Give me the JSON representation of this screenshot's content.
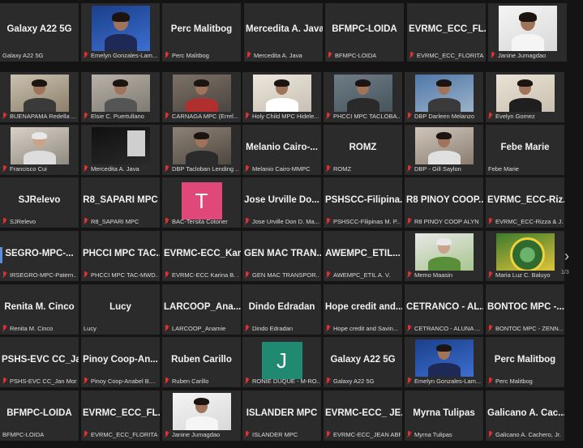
{
  "top_strip": [
    {
      "name": "Galaxy A22 5G",
      "caption": "Galaxy A22 5G",
      "muted": false,
      "kind": "name"
    },
    {
      "name": "",
      "caption": "Emelyn Gonzales-Lam...",
      "muted": true,
      "kind": "video",
      "video": "stage"
    },
    {
      "name": "Perc Malitbog",
      "caption": "Perc Malitbog",
      "muted": true,
      "kind": "name"
    },
    {
      "name": "Mercedita A. Java",
      "caption": "Mercedita A. Java",
      "muted": true,
      "kind": "name"
    },
    {
      "name": "BFMPC-LOIDA",
      "caption": "BFMPC-LOIDA",
      "muted": true,
      "kind": "name"
    },
    {
      "name": "EVRMC_ECC_FL...",
      "caption": "EVRMC_ECC_FLORITA ...",
      "muted": true,
      "kind": "name"
    },
    {
      "name": "",
      "caption": "Janine Jumagdao",
      "muted": true,
      "kind": "video",
      "video": "portrait"
    }
  ],
  "grid": [
    [
      {
        "name": "",
        "caption": "BUENAPAMA Redella ...",
        "muted": true,
        "kind": "video",
        "video": "office"
      },
      {
        "name": "",
        "caption": "Elsie C. Puertullano",
        "muted": true,
        "kind": "video",
        "video": "room"
      },
      {
        "name": "",
        "caption": "CARNAGA MPC (Errel...",
        "muted": true,
        "kind": "video",
        "video": "office2"
      },
      {
        "name": "",
        "caption": "Holy Child MPC Hidele...",
        "muted": true,
        "kind": "video",
        "video": "light"
      },
      {
        "name": "",
        "caption": "PHCCI MPC TACLOBA...",
        "muted": true,
        "kind": "video",
        "video": "office3"
      },
      {
        "name": "",
        "caption": "DBP Darleen Melanzo",
        "muted": true,
        "kind": "video",
        "video": "city"
      },
      {
        "name": "",
        "caption": "Evelyn Gomez",
        "muted": true,
        "kind": "video",
        "video": "wall"
      }
    ],
    [
      {
        "name": "",
        "caption": "Francisco Cui",
        "muted": true,
        "kind": "video",
        "video": "elder"
      },
      {
        "name": "",
        "caption": "Mercedita A. Java",
        "muted": true,
        "kind": "video",
        "video": "dark"
      },
      {
        "name": "",
        "caption": "DBP Tacloban Lending ...",
        "muted": true,
        "kind": "video",
        "video": "mask"
      },
      {
        "name": "Melanio Cairo-...",
        "caption": "Melanio Cairo-MMPC",
        "muted": true,
        "kind": "name"
      },
      {
        "name": "ROMZ",
        "caption": "ROMZ",
        "muted": true,
        "kind": "name"
      },
      {
        "name": "",
        "caption": "DBP - Gill Saylon",
        "muted": true,
        "kind": "video",
        "video": "woman"
      },
      {
        "name": "Febe Marie",
        "caption": "Febe Marie",
        "muted": false,
        "kind": "name"
      }
    ],
    [
      {
        "name": "SJRelevo",
        "caption": "SJRelevo",
        "muted": true,
        "kind": "name"
      },
      {
        "name": "R8_SAPARI MPC",
        "caption": "R8_SAPARI MPC",
        "muted": true,
        "kind": "name"
      },
      {
        "name": "",
        "caption": "BAC-Tersita Cotoner",
        "muted": true,
        "kind": "avatar",
        "letter": "T",
        "color": "#e0487a"
      },
      {
        "name": "Jose Urville Do...",
        "caption": "Jose Urville Don D. Ma...",
        "muted": true,
        "kind": "name"
      },
      {
        "name": "PSHSCC-Filipina...",
        "caption": "PSHSCC-Filipinas M. P...",
        "muted": true,
        "kind": "name"
      },
      {
        "name": "R8 PINOY COOP...",
        "caption": "R8 PINOY COOP ALYN",
        "muted": true,
        "kind": "name"
      },
      {
        "name": "EVRMC_ECC-Riz...",
        "caption": "EVRMC_ECC-Rizza & J...",
        "muted": true,
        "kind": "name"
      }
    ],
    [
      {
        "name": "SEGRO-MPC-...",
        "caption": "IRSEGRO-MPC-Patern...",
        "muted": true,
        "kind": "name"
      },
      {
        "name": "PHCCI MPC TAC...",
        "caption": "PHCCI MPC TAC-MWD...",
        "muted": true,
        "kind": "name"
      },
      {
        "name": "EVRMC-ECC_Kar...",
        "caption": "EVRMC-ECC Karina B. ...",
        "muted": true,
        "kind": "name"
      },
      {
        "name": "GEN MAC TRAN...",
        "caption": "GEN MAC TRANSPOR...",
        "muted": true,
        "kind": "name"
      },
      {
        "name": "AWEMPC_ETIL...",
        "caption": "AWEMPC_ETIL A. V.",
        "muted": true,
        "kind": "name"
      },
      {
        "name": "",
        "caption": "Memo Maasin",
        "muted": true,
        "kind": "video",
        "video": "elder2"
      },
      {
        "name": "",
        "caption": "Maria Luz C. Baluyo",
        "muted": true,
        "kind": "video",
        "video": "seal"
      }
    ],
    [
      {
        "name": "Renita M. Cinco",
        "caption": "Renita M. Cinco",
        "muted": true,
        "kind": "name"
      },
      {
        "name": "Lucy",
        "caption": "Lucy",
        "muted": false,
        "kind": "name"
      },
      {
        "name": "LARCOOP_Ana...",
        "caption": "LARCOOP_Anamie",
        "muted": true,
        "kind": "name"
      },
      {
        "name": "Dindo Edradan",
        "caption": "Dindo Edradan",
        "muted": true,
        "kind": "name"
      },
      {
        "name": "Hope credit and...",
        "caption": "Hope credit and Savin...",
        "muted": true,
        "kind": "name"
      },
      {
        "name": "CETRANCO - AL...",
        "caption": "CETRANCO - ALUNA ...",
        "muted": true,
        "kind": "name"
      },
      {
        "name": "BONTOC MPC -...",
        "caption": "BONTOC MPC - ZENN...",
        "muted": true,
        "kind": "name"
      }
    ],
    [
      {
        "name": "PSHS-EVC CC_Ja...",
        "caption": "PSHS-EVC CC_Jan Mor...",
        "muted": true,
        "kind": "name"
      },
      {
        "name": "Pinoy Coop-An...",
        "caption": "Pinoy Coop-Anabel B....",
        "muted": true,
        "kind": "name"
      },
      {
        "name": "Ruben Carillo",
        "caption": "Ruben Carillo",
        "muted": true,
        "kind": "name"
      },
      {
        "name": "",
        "caption": "RONIE DUQUE - M-RO...",
        "muted": true,
        "kind": "avatar",
        "letter": "J",
        "color": "#1f8a70"
      },
      {
        "name": "Galaxy A22 5G",
        "caption": "Galaxy A22 5G",
        "muted": true,
        "kind": "name"
      },
      {
        "name": "",
        "caption": "Emelyn Gonzales-Lam...",
        "muted": true,
        "kind": "video",
        "video": "stage"
      },
      {
        "name": "Perc Malitbog",
        "caption": "Perc Malitbog",
        "muted": true,
        "kind": "name"
      }
    ],
    [
      {
        "name": "BFMPC-LOIDA",
        "caption": "BFMPC-LOIDA",
        "muted": false,
        "kind": "name"
      },
      {
        "name": "EVRMC_ECC_FL...",
        "caption": "EVRMC_ECC_FLORITA ...",
        "muted": true,
        "kind": "name"
      },
      {
        "name": "",
        "caption": "Janine Jumagdao",
        "muted": true,
        "kind": "video",
        "video": "portrait"
      },
      {
        "name": "ISLANDER MPC",
        "caption": "ISLANDER MPC",
        "muted": true,
        "kind": "name"
      },
      {
        "name": "EVRMC-ECC_ JE...",
        "caption": "EVRMC-ECC_JEAN ABRIA",
        "muted": true,
        "kind": "name"
      },
      {
        "name": "Myrna Tulipas",
        "caption": "Myrna Tulipas",
        "muted": true,
        "kind": "name"
      },
      {
        "name": "Galicano A. Cac...",
        "caption": "Galicano A. Cachero, Jr.",
        "muted": true,
        "kind": "name"
      }
    ]
  ],
  "nav": {
    "next_icon": "›",
    "page": "1/3"
  }
}
